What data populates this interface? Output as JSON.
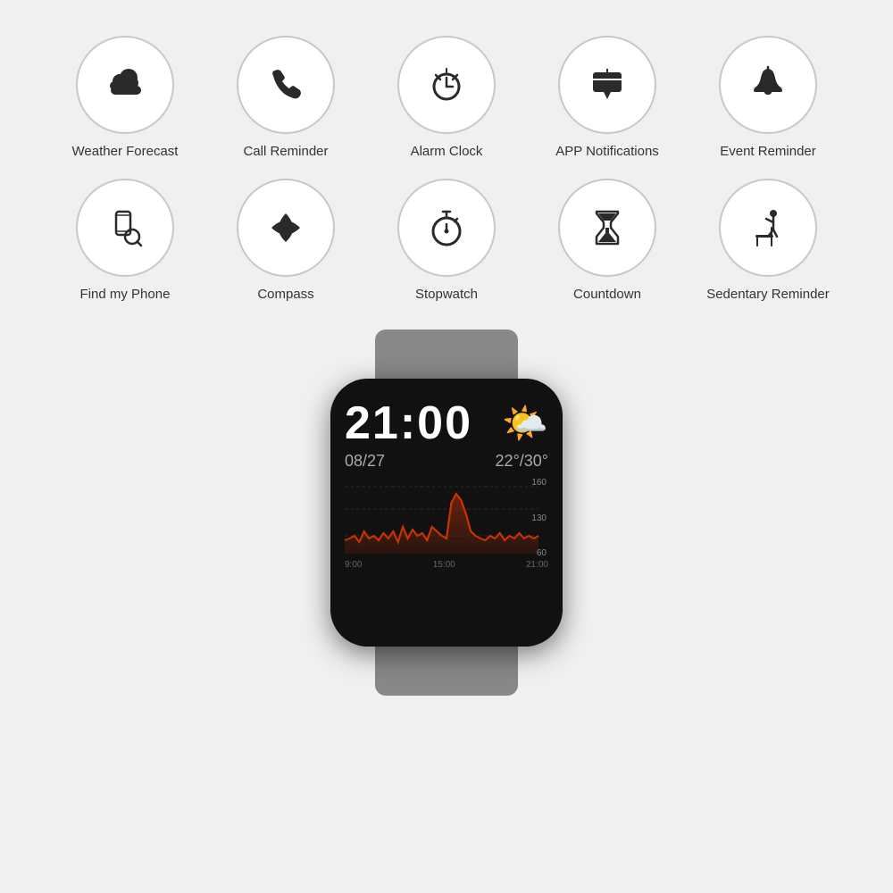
{
  "background": "#f0f0f0",
  "icons_row1": [
    {
      "id": "weather-forecast",
      "label": "Weather Forecast",
      "icon": "weather"
    },
    {
      "id": "call-reminder",
      "label": "Call Reminder",
      "icon": "call"
    },
    {
      "id": "alarm-clock",
      "label": "Alarm Clock",
      "icon": "alarm"
    },
    {
      "id": "app-notifications",
      "label": "APP Notifications",
      "icon": "notification"
    },
    {
      "id": "event-reminder",
      "label": "Event Reminder",
      "icon": "bell"
    }
  ],
  "icons_row2": [
    {
      "id": "find-my-phone",
      "label": "Find my Phone",
      "icon": "findphone"
    },
    {
      "id": "compass",
      "label": "Compass",
      "icon": "compass"
    },
    {
      "id": "stopwatch",
      "label": "Stopwatch",
      "icon": "stopwatch"
    },
    {
      "id": "countdown",
      "label": "Countdown",
      "icon": "countdown"
    },
    {
      "id": "sedentary-reminder",
      "label": "Sedentary Reminder",
      "icon": "sedentary"
    }
  ],
  "watch": {
    "time": "21:00",
    "date": "08/27",
    "temp": "22°/30°",
    "chart_labels": [
      "160",
      "130",
      "60"
    ],
    "chart_times": [
      "9:00",
      "15:00",
      "21:00"
    ]
  }
}
